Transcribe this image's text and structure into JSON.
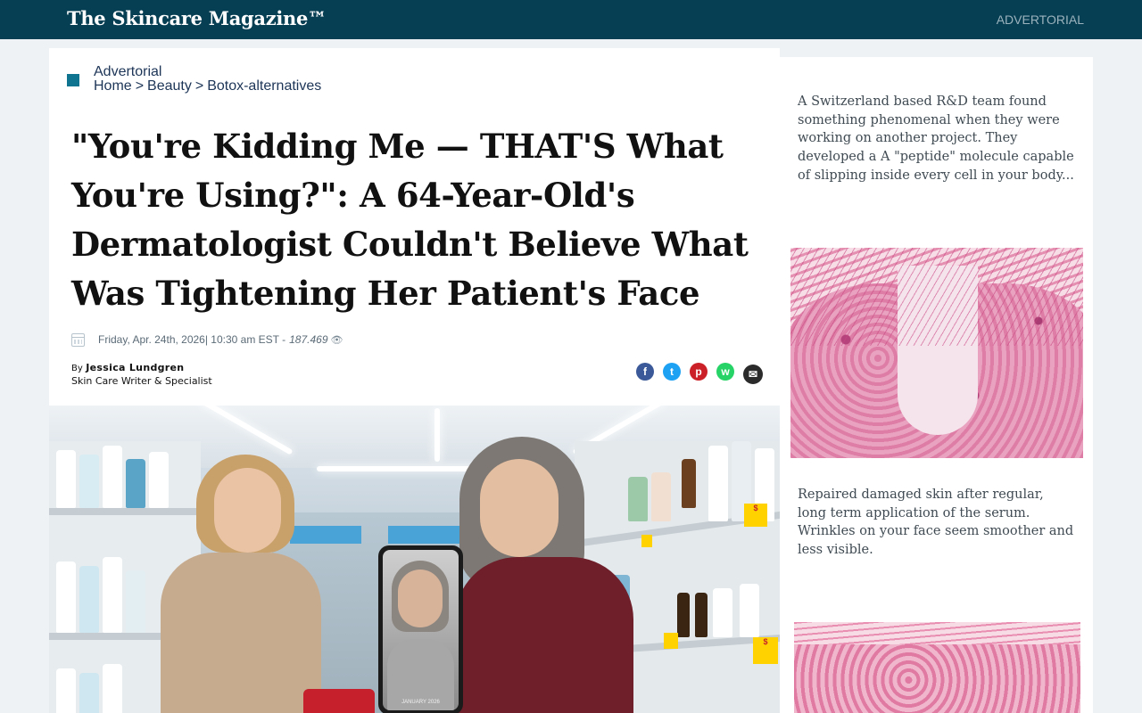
{
  "topbar": {
    "brand": "The Skincare Magazine™",
    "advertorial_label": "ADVERTORIAL"
  },
  "article": {
    "advertorial_label": "Advertorial",
    "breadcrumb": {
      "home": "Home",
      "separator": ">",
      "beauty": "Beauty",
      "section": "Botox-alternatives"
    },
    "headline": "\"You're Kidding Me — THAT'S What You're Using?\": A 64-Year-Old's Dermatologist Couldn't Believe What Was Tightening Her Patient's Face",
    "meta": {
      "date": "Friday, Apr. 24th, 2026| 10:30 am EST -",
      "views": "187.469",
      "eye_glyph": "👁"
    },
    "byline": {
      "by": "By",
      "author": "Jessica Lundgren",
      "title": "Skin Care Writer & Specialist"
    },
    "share": {
      "facebook": "f",
      "twitter": "t",
      "pinterest": "p",
      "whatsapp": "w",
      "email": "✉"
    },
    "hero": {
      "phone_caption": "JANUARY 2026"
    }
  },
  "sidebar": {
    "text_1": "A Switzerland based R&D team found something phenomenal when they were working on another project. They developed a A \"peptide\" molecule capable of slipping inside every cell in your body...",
    "text_2": "Repaired damaged skin after regular, long term application of the serum. Wrinkles on your face seem smoother and less visible."
  },
  "colors": {
    "topbar": "#063e53",
    "accent": "#0e7490",
    "facebook": "#3b5998",
    "twitter": "#1da1f2",
    "pinterest": "#cb2027",
    "whatsapp": "#25d366"
  },
  "icons": {
    "calendar": "calendar-icon",
    "eye": "eye-icon",
    "facebook": "facebook-icon",
    "twitter": "twitter-icon",
    "pinterest": "pinterest-icon",
    "whatsapp": "whatsapp-icon",
    "email": "email-icon"
  }
}
